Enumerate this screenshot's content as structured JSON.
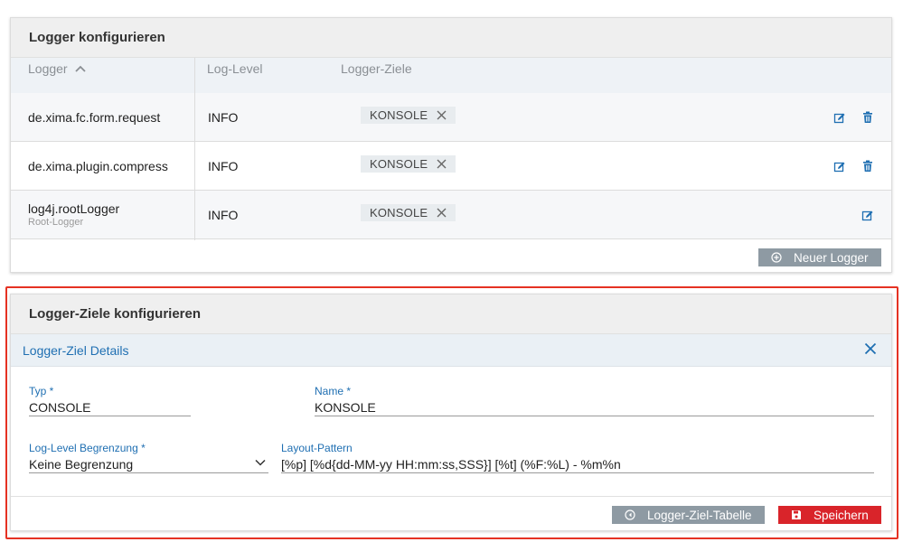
{
  "logger_panel": {
    "title": "Logger konfigurieren",
    "columns": {
      "logger": "Logger",
      "log_level": "Log-Level",
      "targets": "Logger-Ziele"
    },
    "rows": [
      {
        "name": "de.xima.fc.form.request",
        "subtitle": "",
        "level": "INFO",
        "target": "KONSOLE"
      },
      {
        "name": "de.xima.plugin.compress",
        "subtitle": "",
        "level": "INFO",
        "target": "KONSOLE"
      },
      {
        "name": "log4j.rootLogger",
        "subtitle": "Root-Logger",
        "level": "INFO",
        "target": "KONSOLE"
      }
    ],
    "new_logger_label": "Neuer Logger"
  },
  "target_panel": {
    "title": "Logger-Ziele konfigurieren",
    "details_title": "Logger-Ziel Details",
    "typ_label": "Typ *",
    "typ_value": "CONSOLE",
    "name_label": "Name *",
    "name_value": "KONSOLE",
    "level_limit_label": "Log-Level Begrenzung *",
    "level_limit_value": "Keine Begrenzung",
    "pattern_label": "Layout-Pattern",
    "pattern_value": "[%p] [%d{dd-MM-yy HH:mm:ss,SSS}] [%t] (%F:%L) - %m%n",
    "table_button_label": "Logger-Ziel-Tabelle",
    "save_button_label": "Speichern"
  },
  "colors": {
    "accent_blue": "#1f6fb2",
    "highlight_red": "#e53223",
    "save_red": "#d9242a",
    "button_grey": "#8e9aa3"
  },
  "icons": [
    "chevron-up-icon",
    "remove-x-icon",
    "edit-icon",
    "trash-icon",
    "plus-circle-icon",
    "close-icon",
    "chevron-down-icon",
    "arrow-circle-icon",
    "save-icon"
  ]
}
